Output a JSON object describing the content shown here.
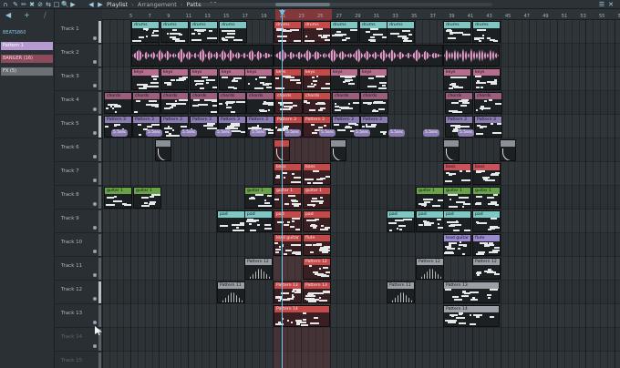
{
  "window": {
    "breadcrumb": [
      "Playlist",
      "Arrangement",
      "Pattern 13"
    ]
  },
  "toolbar": {
    "icons": [
      "magnet-icon",
      "draw-icon",
      "paint-icon",
      "delete-icon",
      "mute-icon",
      "slip-icon",
      "select-icon",
      "zoom-icon",
      "playback-icon"
    ]
  },
  "sidebar": {
    "patterns": [
      {
        "label": "BEATS860",
        "color": "#2b3034",
        "text": "#7fc6e4"
      },
      {
        "label": "Pattern 1",
        "color": "#b79ad1",
        "text": "#ffffff"
      },
      {
        "label": "BANGER (16)",
        "color": "#8c4a5c",
        "text": "#f2dde3"
      },
      {
        "label": "FX (5)",
        "color": "#6b7075",
        "text": "#e9eef1"
      }
    ]
  },
  "ruler": {
    "labels": [
      "5",
      "7",
      "9",
      "11",
      "13",
      "15",
      "17",
      "19",
      "21",
      "23",
      "25",
      "27",
      "29",
      "31",
      "33",
      "35",
      "37",
      "39",
      "41",
      "43",
      "45",
      "47",
      "49",
      "51",
      "53",
      "55",
      "57"
    ]
  },
  "tracks": [
    {
      "name": "Track 1"
    },
    {
      "name": "Track 2"
    },
    {
      "name": "Track 3"
    },
    {
      "name": "Track 4"
    },
    {
      "name": "Track 5"
    },
    {
      "name": "Track 6"
    },
    {
      "name": "Track 7"
    },
    {
      "name": "Track 8"
    },
    {
      "name": "Track 9"
    },
    {
      "name": "Track 10"
    },
    {
      "name": "Track 11"
    },
    {
      "name": "Track 12"
    },
    {
      "name": "Track 13"
    },
    {
      "name": "Track 14"
    },
    {
      "name": "Track 15"
    }
  ],
  "clip_styles": {
    "drums": "#7ec8c4",
    "sample": "#c07bb0",
    "keys": "#b66d8e",
    "chords": "#9a5f7c",
    "arp": "#8a7bb0",
    "fx": "#8a9096",
    "bass": "#c9525c",
    "guitar": "#6aa24a",
    "pad": "#7ec8c4",
    "lead": "#9a8ad0",
    "pattern": "#9aa0a6",
    "selected": "#c44a4a"
  },
  "clips": [
    {
      "track": 0,
      "label": "drums",
      "style": "drums",
      "segments": [
        "drums",
        "drums",
        "drums",
        "drums",
        "drums",
        "drums",
        "drums",
        "drums"
      ]
    },
    {
      "track": 3,
      "label": "chords",
      "style": "chords",
      "segments": [
        "chords",
        "chords",
        "chords",
        "chords",
        "chords",
        "chords",
        "chords",
        "chords",
        "chords",
        "chords",
        "chords",
        "chords",
        "chords",
        "chords"
      ]
    },
    {
      "track": 2,
      "label": "keys",
      "style": "keys",
      "segments": [
        "keys",
        "keys",
        "keys",
        "keys",
        "keys",
        "keys",
        "keys",
        "keys",
        "keys",
        "keys"
      ]
    },
    {
      "track": 4,
      "label": "Pattern 3",
      "style": "arp",
      "segments": [
        "Pattern 3",
        "Pattern 3",
        "Pattern 3",
        "Pattern 3",
        "Pattern 3",
        "Pattern 3",
        "Pattern 3",
        "Pattern 3",
        "Pattern 3",
        "Pattern 3",
        "Pattern 3",
        "Pattern 3",
        "Pattern 3"
      ]
    },
    {
      "track": 6,
      "label": "bass",
      "style": "bass",
      "segments": [
        "bass",
        "bass",
        "bass",
        "bass"
      ]
    },
    {
      "track": 7,
      "label": "guitar 1",
      "style": "guitar",
      "segments": [
        "guitar 1",
        "guitar 1",
        "guitar 1",
        "guitar 1",
        "guitar 1",
        "guitar 1",
        "guitar 1",
        "guitar 1"
      ]
    },
    {
      "track": 8,
      "label": "pad",
      "style": "pad",
      "segments": [
        "pad",
        "pad",
        "pad",
        "pad",
        "pad",
        "pad",
        "pad",
        "pad",
        "pad"
      ]
    },
    {
      "track": 9,
      "label": "lead guitar",
      "style": "lead",
      "segments": [
        "lead guitar",
        "flute",
        "lead guitar",
        "flute"
      ]
    },
    {
      "track": 10,
      "label": "Pattern 12",
      "style": "pattern",
      "segments": [
        "Pattern 12",
        "Pattern 12",
        "Pattern 12",
        "Pattern 12"
      ]
    },
    {
      "track": 11,
      "label": "Pattern 13",
      "style": "pattern",
      "segments": [
        "Pattern 11",
        "Pattern 13",
        "Pattern 13",
        "Pattern 11",
        "Pattern 13"
      ]
    },
    {
      "track": 12,
      "label": "Pattern 14",
      "style": "pattern",
      "segments": [
        "Pattern 14",
        "Pattern 14"
      ]
    }
  ],
  "fx_track": {
    "label": "5.5sec",
    "count": 11
  }
}
